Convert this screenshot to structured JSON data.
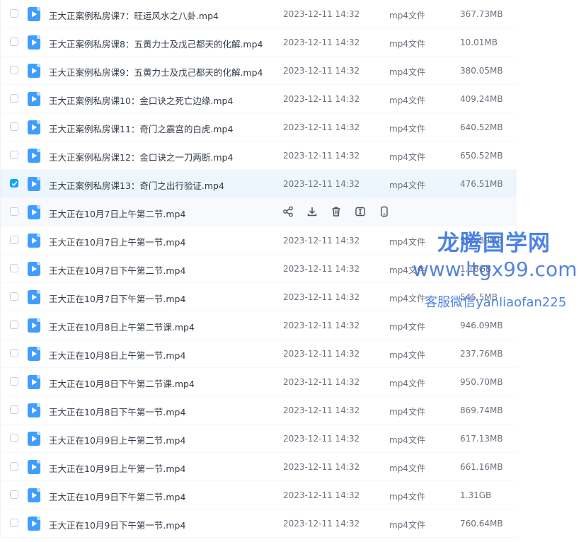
{
  "colors": {
    "accent": "#06a7ff",
    "file_icon": "#3f9dff",
    "selected_row": "#eef6fd",
    "watermark": "#2f6ee0"
  },
  "files": [
    {
      "name": "王大正案例私房课7：旺运风水之八卦.mp4",
      "date": "2023-12-11 14:32",
      "type": "mp4文件",
      "size": "367.73MB"
    },
    {
      "name": "王大正案例私房课8：五黄力士及戊己都天的化解.mp4",
      "date": "2023-12-11 14:32",
      "type": "mp4文件",
      "size": "10.01MB"
    },
    {
      "name": "王大正案例私房课9：五黄力士及戊己都天的化解.mp4",
      "date": "2023-12-11 14:32",
      "type": "mp4文件",
      "size": "380.05MB"
    },
    {
      "name": "王大正案例私房课10：金口诀之死亡边缘.mp4",
      "date": "2023-12-11 14:32",
      "type": "mp4文件",
      "size": "409.24MB"
    },
    {
      "name": "王大正案例私房课11：奇门之震宫的白虎.mp4",
      "date": "2023-12-11 14:32",
      "type": "mp4文件",
      "size": "640.52MB"
    },
    {
      "name": "王大正案例私房课12：金口诀之一刀两断.mp4",
      "date": "2023-12-11 14:32",
      "type": "mp4文件",
      "size": "650.52MB"
    },
    {
      "name": "王大正案例私房课13：奇门之出行验证.mp4",
      "date": "2023-12-11 14:32",
      "type": "mp4文件",
      "size": "476.51MB"
    },
    {
      "name": "王大正在10月7日上午第二节.mp4",
      "date": "",
      "type": "",
      "size": ""
    },
    {
      "name": "王大正在10月7日上午第一节.mp4",
      "date": "2023-12-11 14:32",
      "type": "mp4文件",
      "size": "509.39MB"
    },
    {
      "name": "王大正在10月7日下午第二节.mp4",
      "date": "2023-12-11 14:32",
      "type": "mp4文件",
      "size": "1.18GB"
    },
    {
      "name": "王大正在10月7日下午第一节.mp4",
      "date": "2023-12-11 14:32",
      "type": "mp4文件",
      "size": "545.5MB"
    },
    {
      "name": "王大正在10月8日上午第二节课.mp4",
      "date": "2023-12-11 14:32",
      "type": "mp4文件",
      "size": "946.09MB"
    },
    {
      "name": "王大正在10月8日上午第一节.mp4",
      "date": "2023-12-11 14:32",
      "type": "mp4文件",
      "size": "237.76MB"
    },
    {
      "name": "王大正在10月8日下午第二节课.mp4",
      "date": "2023-12-11 14:32",
      "type": "mp4文件",
      "size": "950.70MB"
    },
    {
      "name": "王大正在10月8日下午第一节.mp4",
      "date": "2023-12-11 14:32",
      "type": "mp4文件",
      "size": "869.74MB"
    },
    {
      "name": "王大正在10月9日上午第二节.mp4",
      "date": "2023-12-11 14:32",
      "type": "mp4文件",
      "size": "617.13MB"
    },
    {
      "name": "王大正在10月9日上午第一节.mp4",
      "date": "2023-12-11 14:32",
      "type": "mp4文件",
      "size": "661.16MB"
    },
    {
      "name": "王大正在10月9日下午第二节.mp4",
      "date": "2023-12-11 14:32",
      "type": "mp4文件",
      "size": "1.31GB"
    },
    {
      "name": "王大正在10月9日下午第一节.mp4",
      "date": "2023-12-11 14:32",
      "type": "mp4文件",
      "size": "760.64MB"
    }
  ],
  "selected_index": 6,
  "hovered_index": 7,
  "row_actions": [
    "share-icon",
    "download-icon",
    "delete-icon",
    "rename-icon",
    "mobile-icon"
  ],
  "watermark": {
    "line1": "龙腾国学网",
    "line2": "www.ltgx99.com",
    "line3": "客服微信yanliaofan225"
  }
}
